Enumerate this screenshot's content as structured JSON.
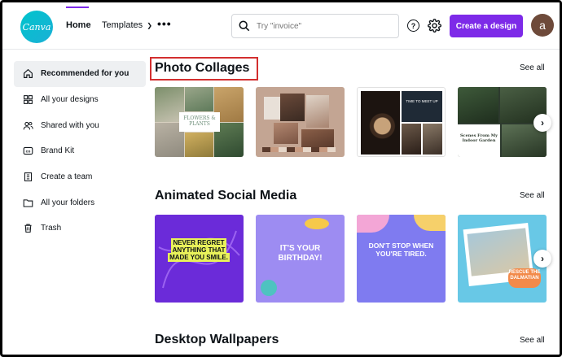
{
  "header": {
    "logo_text": "Canva",
    "nav_home": "Home",
    "nav_templates": "Templates",
    "search_placeholder": "Try \"invoice\"",
    "help_symbol": "?",
    "create_button": "Create a design",
    "avatar_initial": "a"
  },
  "sidebar": {
    "items": [
      {
        "label": "Recommended for you",
        "icon": "home-icon"
      },
      {
        "label": "All your designs",
        "icon": "grid-icon"
      },
      {
        "label": "Shared with you",
        "icon": "people-icon"
      },
      {
        "label": "Brand Kit",
        "icon": "brand-kit-icon"
      },
      {
        "label": "Create a team",
        "icon": "building-icon"
      },
      {
        "label": "All your folders",
        "icon": "folder-icon"
      },
      {
        "label": "Trash",
        "icon": "trash-icon"
      }
    ]
  },
  "sections": [
    {
      "title": "Photo Collages",
      "see_all": "See all"
    },
    {
      "title": "Animated Social Media",
      "see_all": "See all"
    },
    {
      "title": "Desktop Wallpapers",
      "see_all": "See all"
    }
  ],
  "collage_cards": [
    {
      "text": "FLOWERS & PLANTS"
    },
    {
      "text": ""
    },
    {
      "text": "TIME TO MEET UP"
    },
    {
      "text": "Scenes From My Indoor Garden"
    }
  ],
  "social_cards": [
    {
      "text": "NEVER REGRET ANYTHING THAT MADE YOU SMILE.",
      "bg": "#6b2bd9"
    },
    {
      "text": "IT'S YOUR BIRTHDAY!",
      "bg": "#9d8cf2"
    },
    {
      "text": "DON'T STOP WHEN YOU'RE TIRED.",
      "bg": "#7f7bf0"
    },
    {
      "text": "RESCUE THE DALMATIAN",
      "bg": "#68c8e6"
    }
  ],
  "colors": {
    "accent": "#7d2ae8",
    "highlight_border": "#d32f2f"
  }
}
